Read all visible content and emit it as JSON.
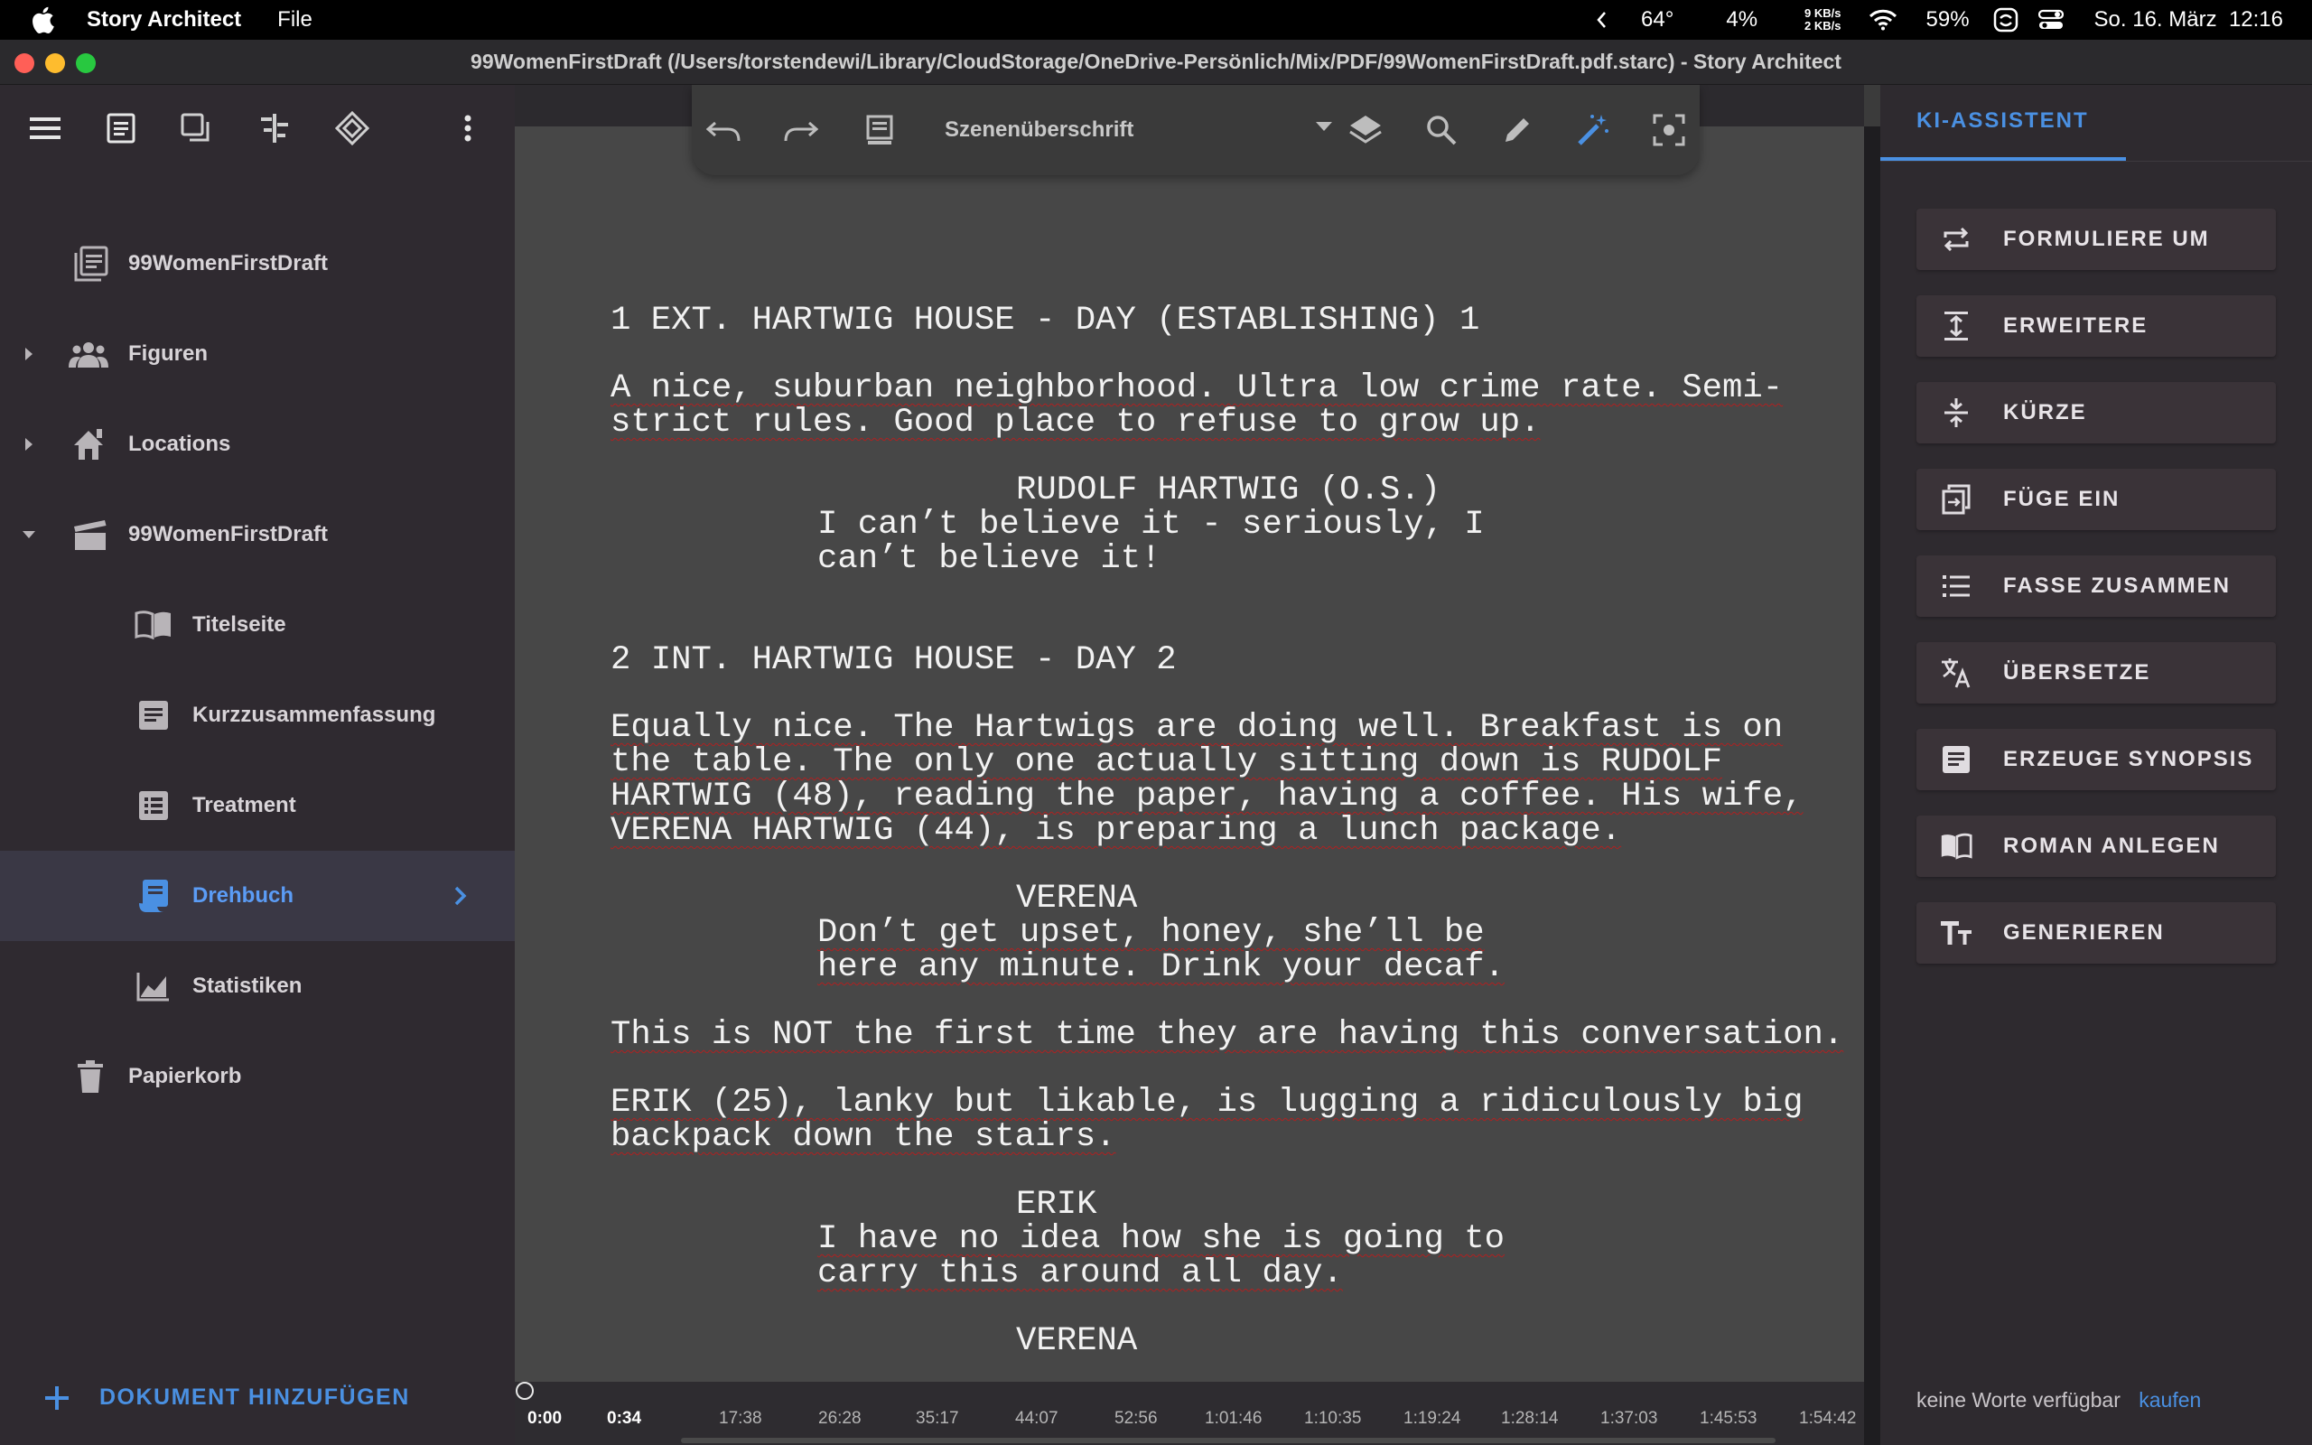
{
  "menubar": {
    "app_name": "Story Architect",
    "menu_file": "File",
    "temperature": "64°",
    "cpu": "4%",
    "net_up": "9 KB/s",
    "net_down": "2 KB/s",
    "battery": "59%",
    "datetime": "So. 16. März  12:16"
  },
  "window": {
    "title": "99WomenFirstDraft (/Users/torstendewi/Library/CloudStorage/OneDrive-Persönlich/Mix/PDF/99WomenFirstDraft.pdf.starc) - Story Architect"
  },
  "sidebar": {
    "items": [
      {
        "label": "99WomenFirstDraft",
        "icon": "project-icon"
      },
      {
        "label": "Figuren",
        "icon": "people-icon"
      },
      {
        "label": "Locations",
        "icon": "locations-icon"
      },
      {
        "label": "99WomenFirstDraft",
        "icon": "clapperboard-icon"
      },
      {
        "label": "Titelseite",
        "icon": "book-open-icon"
      },
      {
        "label": "Kurzzusammenfassung",
        "icon": "document-icon"
      },
      {
        "label": "Treatment",
        "icon": "list-document-icon"
      },
      {
        "label": "Drehbuch",
        "icon": "script-icon"
      },
      {
        "label": "Statistiken",
        "icon": "chart-icon"
      },
      {
        "label": "Papierkorb",
        "icon": "trash-icon"
      }
    ],
    "add_document": "DOKUMENT HINZUFÜGEN"
  },
  "editor": {
    "paragraph_style": "Szenenüberschrift",
    "lines": [
      "1 EXT. HARTWIG HOUSE - DAY (ESTABLISHING) 1",
      "A nice, suburban neighborhood. Ultra low crime rate. Semi-",
      "strict rules. Good place to refuse to grow up.",
      "RUDOLF HARTWIG (O.S.)",
      "I can’t believe it - seriously, I",
      "can’t believe it!",
      "2 INT. HARTWIG HOUSE - DAY 2",
      "Equally nice. The Hartwigs are doing well. Breakfast is on",
      "the table. The only one actually sitting down is RUDOLF",
      "HARTWIG (48), reading the paper, having a coffee. His wife,",
      "VERENA HARTWIG (44), is preparing a lunch package.",
      "VERENA",
      "Don’t get upset, honey, she’ll be",
      "here any minute. Drink your decaf.",
      "This is NOT the first time they are having this conversation.",
      "ERIK (25), lanky but likable, is lugging a ridiculously big",
      "backpack down the stairs.",
      "ERIK",
      "I have no idea how she is going to",
      "carry this around all day.",
      "VERENA"
    ],
    "timeline": [
      "0:00",
      "0:34",
      "17:38",
      "26:28",
      "35:17",
      "44:07",
      "52:56",
      "1:01:46",
      "1:10:35",
      "1:19:24",
      "1:28:14",
      "1:37:03",
      "1:45:53",
      "1:54:42"
    ]
  },
  "ai_panel": {
    "tab": "KI-ASSISTENT",
    "buttons": [
      {
        "label": "FORMULIERE UM",
        "icon": "rephrase-icon"
      },
      {
        "label": "ERWEITERE",
        "icon": "expand-icon"
      },
      {
        "label": "KÜRZE",
        "icon": "shorten-icon"
      },
      {
        "label": "FÜGE EIN",
        "icon": "insert-icon"
      },
      {
        "label": "FASSE ZUSAMMEN",
        "icon": "summarize-icon"
      },
      {
        "label": "ÜBERSETZE",
        "icon": "translate-icon"
      },
      {
        "label": "ERZEUGE SYNOPSIS",
        "icon": "synopsis-icon"
      },
      {
        "label": "ROMAN ANLEGEN",
        "icon": "novel-icon"
      },
      {
        "label": "GENERIEREN",
        "icon": "text-size-icon"
      }
    ],
    "footer_text": "keine Worte verfügbar",
    "footer_link": "kaufen"
  },
  "colors": {
    "accent": "#4a90e2",
    "editor_bg": "#474747",
    "sidebar_bg": "#2f2a30",
    "spell_error": "#b02020"
  }
}
